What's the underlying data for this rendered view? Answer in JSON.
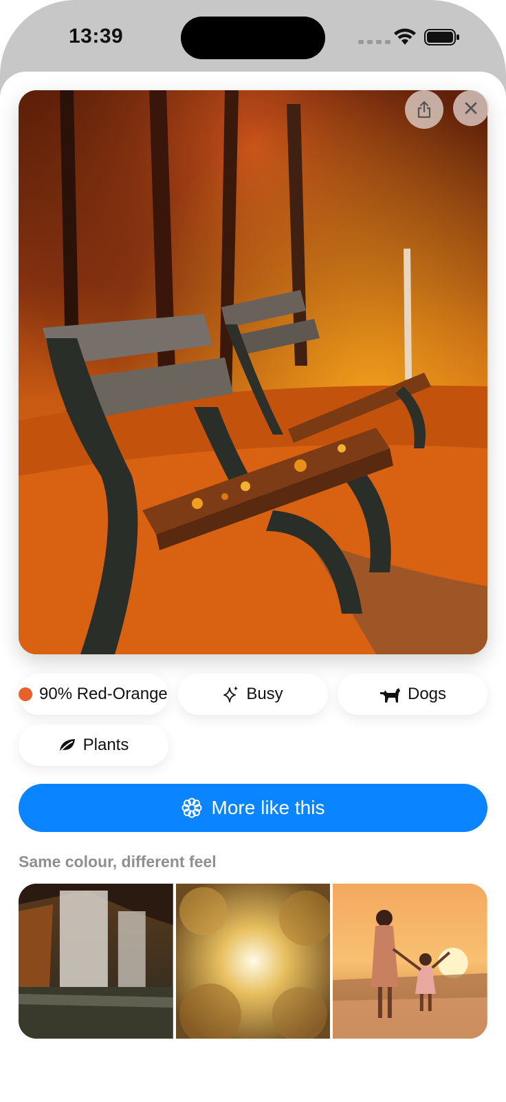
{
  "status_bar": {
    "time": "13:39"
  },
  "hero": {
    "image": "autumn-park-benches-photo"
  },
  "actions": {
    "share_icon": "share-icon",
    "close_icon": "close-icon"
  },
  "tags": [
    {
      "label": "90% Red-Orange",
      "icon": "color-dot",
      "color": "#e8602c"
    },
    {
      "label": "Busy",
      "icon": "sparkle-icon"
    },
    {
      "label": "Dogs",
      "icon": "dog-icon"
    },
    {
      "label": "Plants",
      "icon": "leaf-icon"
    }
  ],
  "more_button": {
    "label": "More like this",
    "icon": "flower-icon",
    "color": "#0a84ff"
  },
  "related": {
    "title": "Same colour, different feel",
    "images": [
      "waterfall-photo",
      "golden-clouds-photo",
      "sunset-beach-family-photo"
    ]
  }
}
